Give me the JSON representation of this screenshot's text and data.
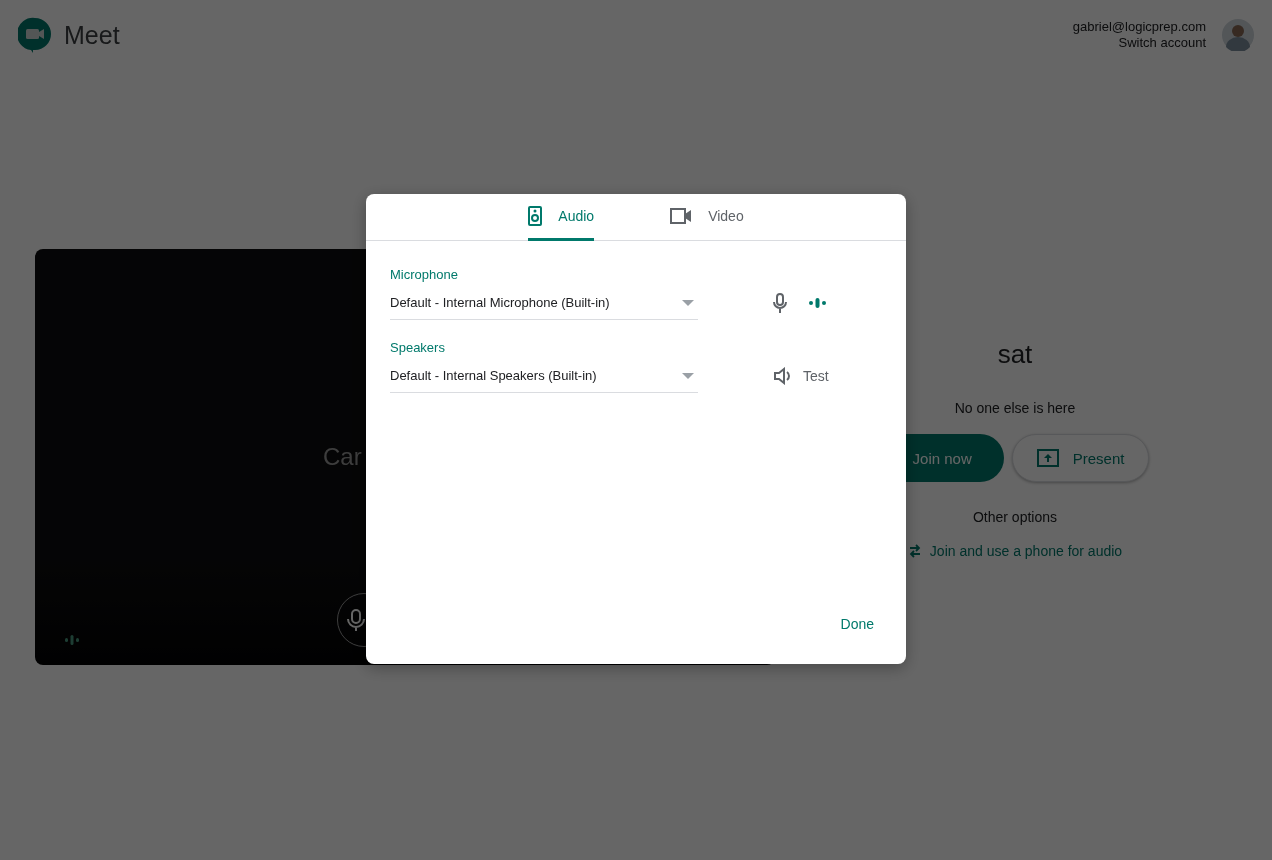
{
  "header": {
    "product": "Meet",
    "account_email": "gabriel@logicprep.com",
    "switch_account": "Switch account"
  },
  "preview": {
    "status_text": "Car"
  },
  "meeting": {
    "title": "sat",
    "status": "No one else is here",
    "buttons": [
      {
        "label": "Join now",
        "kind": "primary"
      },
      {
        "label": "Present",
        "kind": "present"
      }
    ],
    "other_options": "Other options",
    "phone_link": "Join and use a phone for audio"
  },
  "dialog": {
    "tabs": [
      {
        "label": "Audio",
        "kind": "audio",
        "selected": true
      },
      {
        "label": "Video",
        "kind": "video",
        "selected": false
      }
    ],
    "devices": [
      {
        "label": "Microphone",
        "value": "Default - Internal Microphone (Built-in)",
        "kind": "microphone"
      },
      {
        "label": "Speakers",
        "value": "Default - Internal Speakers (Built-in)",
        "kind": "speakers",
        "action": "Test"
      }
    ],
    "done": "Done"
  }
}
